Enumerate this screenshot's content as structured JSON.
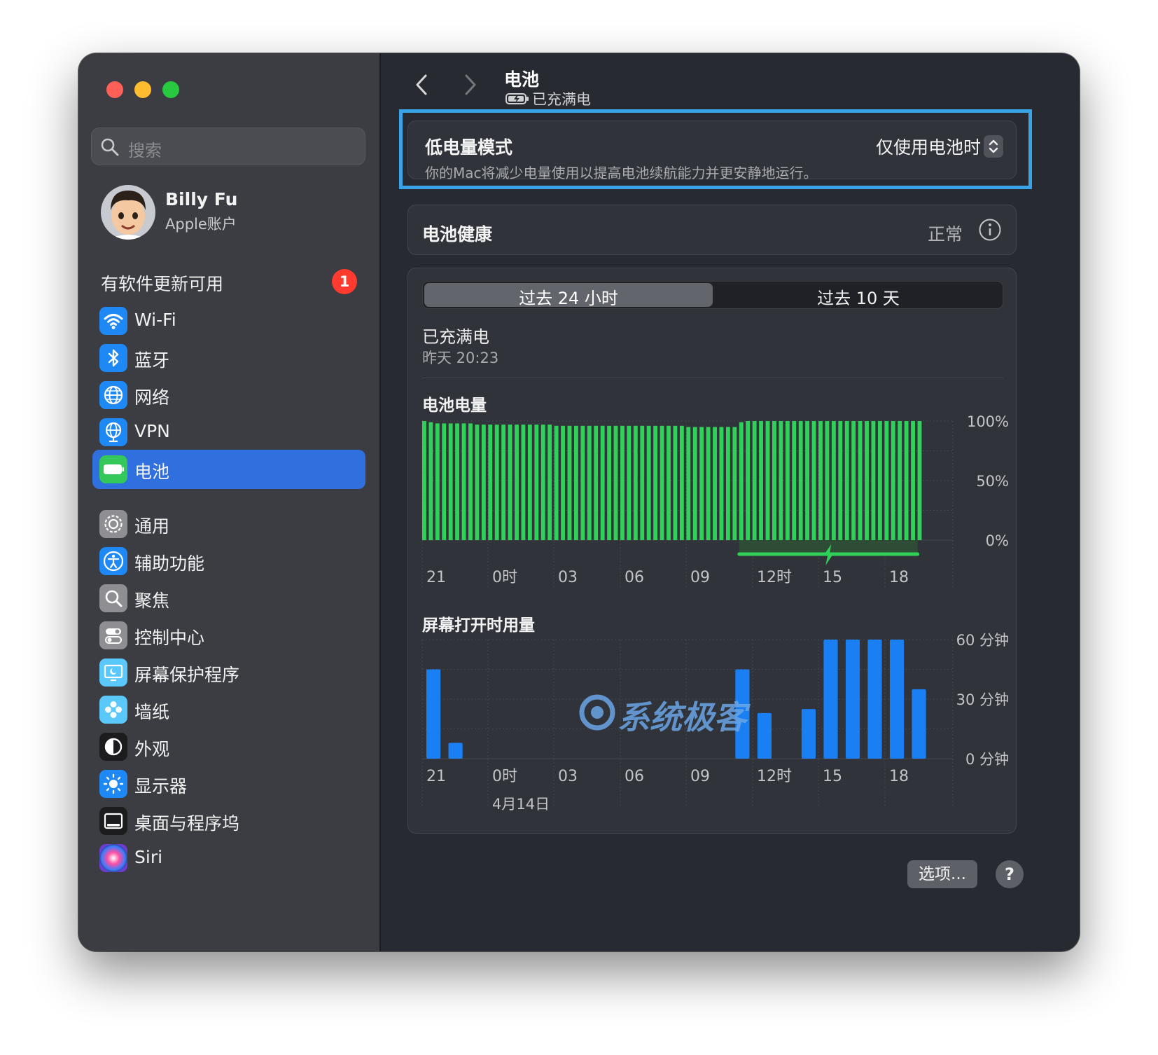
{
  "sidebar": {
    "search_placeholder": "搜索",
    "user": {
      "name": "Billy Fu",
      "subtitle": "Apple账户"
    },
    "update": {
      "label": "有软件更新可用",
      "badge": "1"
    },
    "items": [
      {
        "label": "Wi-Fi",
        "icon": "wifi-icon",
        "color": "#1e88f5"
      },
      {
        "label": "蓝牙",
        "icon": "bluetooth-icon",
        "color": "#1e88f5"
      },
      {
        "label": "网络",
        "icon": "globe-icon",
        "color": "#1e88f5"
      },
      {
        "label": "VPN",
        "icon": "vpn-globe-icon",
        "color": "#1e88f5"
      },
      {
        "label": "电池",
        "icon": "battery-icon",
        "color": "#34c759",
        "active": true
      },
      {
        "label": "通用",
        "icon": "gear-icon",
        "color": "#8e8e93"
      },
      {
        "label": "辅助功能",
        "icon": "accessibility-icon",
        "color": "#1e88f5"
      },
      {
        "label": "聚焦",
        "icon": "magnifier-icon",
        "color": "#8e8e93"
      },
      {
        "label": "控制中心",
        "icon": "toggles-icon",
        "color": "#8e8e93"
      },
      {
        "label": "屏幕保护程序",
        "icon": "screensaver-icon",
        "color": "#5ac8fa"
      },
      {
        "label": "墙纸",
        "icon": "flower-icon",
        "color": "#5ac8fa"
      },
      {
        "label": "外观",
        "icon": "appearance-icon",
        "color": "#1c1c1e"
      },
      {
        "label": "显示器",
        "icon": "sun-icon",
        "color": "#1e88f5"
      },
      {
        "label": "桌面与程序坞",
        "icon": "dock-icon",
        "color": "#1c1c1e"
      },
      {
        "label": "Siri",
        "icon": "siri-icon",
        "color": "#6e3bd4"
      }
    ]
  },
  "header": {
    "title": "电池",
    "subtitle": "已充满电"
  },
  "low_power": {
    "title": "低电量模式",
    "description": "你的Mac将减少电量使用以提高电池续航能力并更安静地运行。",
    "value": "仅使用电池时"
  },
  "health": {
    "title": "电池健康",
    "value": "正常"
  },
  "tabs": {
    "tab1": "过去 24 小时",
    "tab2": "过去 10 天"
  },
  "status": {
    "title": "已充满电",
    "time": "昨天 20:23"
  },
  "battery_chart": {
    "title": "电池电量"
  },
  "screen_chart": {
    "title": "屏幕打开时用量"
  },
  "watermark": "系统极客",
  "buttons": {
    "options": "选项...",
    "help": "?"
  },
  "chart_data": [
    {
      "type": "bar",
      "title": "电池电量",
      "x_ticks": [
        "21",
        "0时",
        "03",
        "06",
        "09",
        "12时",
        "15",
        "18"
      ],
      "y_ticks": [
        "100%",
        "50%",
        "0%"
      ],
      "ylim": [
        0,
        100
      ],
      "color": "#30d158",
      "charging_indicator": {
        "from_bar": 48,
        "to_bar": 75
      },
      "values": [
        100,
        99,
        98,
        98,
        98,
        98,
        98,
        98,
        97,
        97,
        97,
        97,
        97,
        97,
        97,
        97,
        97,
        97,
        97,
        97,
        96,
        96,
        96,
        96,
        96,
        96,
        96,
        96,
        96,
        96,
        96,
        96,
        96,
        96,
        96,
        96,
        96,
        96,
        96,
        96,
        95,
        95,
        95,
        95,
        95,
        95,
        95,
        95,
        99,
        100,
        100,
        100,
        100,
        100,
        100,
        100,
        100,
        100,
        100,
        100,
        100,
        100,
        100,
        100,
        100,
        100,
        100,
        100,
        100,
        100,
        100,
        100,
        100,
        100,
        100,
        100
      ]
    },
    {
      "type": "bar",
      "title": "屏幕打开时用量",
      "x_ticks": [
        "21",
        "0时",
        "03",
        "06",
        "09",
        "12时",
        "15",
        "18"
      ],
      "x_date": "4月14日",
      "y_ticks": [
        "60 分钟",
        "30 分钟",
        "0 分钟"
      ],
      "ylim": [
        0,
        60
      ],
      "color": "#1a7ff2",
      "values": [
        45,
        8,
        0,
        0,
        0,
        0,
        0,
        0,
        0,
        0,
        0,
        0,
        0,
        0,
        45,
        23,
        0,
        25,
        60,
        60,
        60,
        60,
        35
      ]
    }
  ]
}
